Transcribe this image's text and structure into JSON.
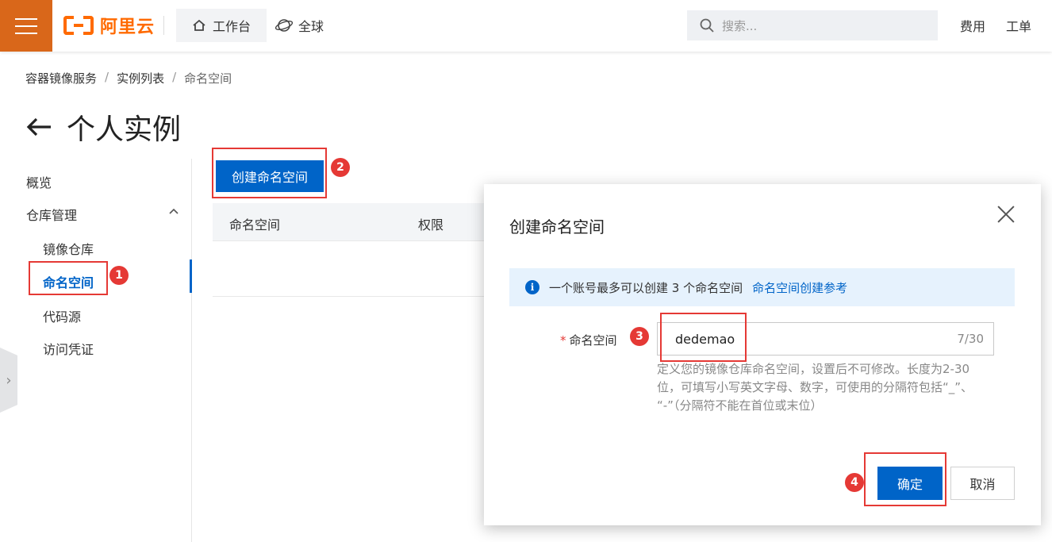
{
  "header": {
    "brand": "阿里云",
    "workbench": "工作台",
    "region": "全球",
    "search_placeholder": "搜索...",
    "links": [
      "费用",
      "工单"
    ]
  },
  "breadcrumb": [
    "容器镜像服务",
    "实例列表",
    "命名空间"
  ],
  "page_title": "个人实例",
  "sidebar": {
    "items": [
      {
        "label": "概览"
      },
      {
        "label": "仓库管理"
      },
      {
        "label": "镜像仓库"
      },
      {
        "label": "命名空间"
      },
      {
        "label": "代码源"
      },
      {
        "label": "访问凭证"
      }
    ]
  },
  "main": {
    "create_button": "创建命名空间",
    "columns": [
      "命名空间",
      "权限"
    ]
  },
  "annotations": [
    "1",
    "2",
    "3",
    "4"
  ],
  "dialog": {
    "title": "创建命名空间",
    "info_text": "一个账号最多可以创建 3 个命名空间",
    "info_link": "命名空间创建参考",
    "required_mark": "*",
    "field_label": "命名空间",
    "field_value": "dedemao",
    "field_count": "7/30",
    "help_lines": [
      "定义您的镜像仓库命名空间，设置后不可修改。长度为2-30",
      "位，可填写小写英文字母、数字，可使用的分隔符包括“_”、",
      "“-”（分隔符不能在首位或末位）"
    ],
    "ok": "确定",
    "cancel": "取消"
  },
  "colors": {
    "brand": "#ff6a00",
    "primary": "#0064c8",
    "annotation": "#e53935"
  }
}
